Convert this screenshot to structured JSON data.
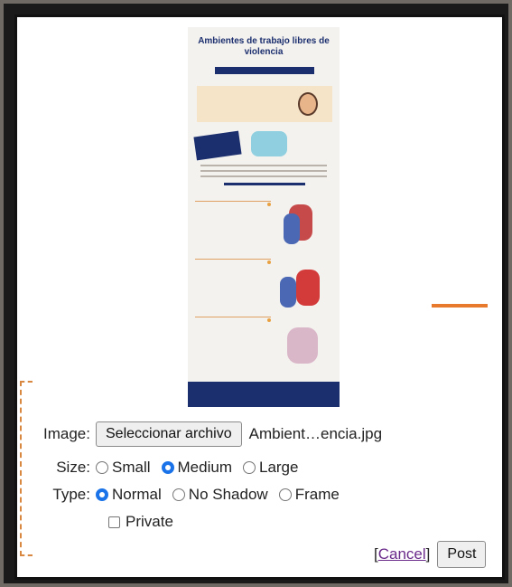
{
  "infographic": {
    "title": "Ambientes de trabajo libres de violencia"
  },
  "form": {
    "image_label": "Image:",
    "file_button": "Seleccionar archivo",
    "file_name": "Ambient…encia.jpg",
    "size_label": "Size:",
    "size_options": [
      "Small",
      "Medium",
      "Large"
    ],
    "size_selected": "Medium",
    "type_label": "Type:",
    "type_options": [
      "Normal",
      "No Shadow",
      "Frame"
    ],
    "type_selected": "Normal",
    "private_label": "Private",
    "private_checked": false,
    "cancel_open": "[",
    "cancel_label": "Cancel",
    "cancel_close": "]",
    "post_label": "Post"
  },
  "colors": {
    "accent_orange": "#e87a2e",
    "selected_radio": "#1a73e8",
    "link_visited": "#6a2a8a",
    "infographic_navy": "#1b2f6e"
  }
}
